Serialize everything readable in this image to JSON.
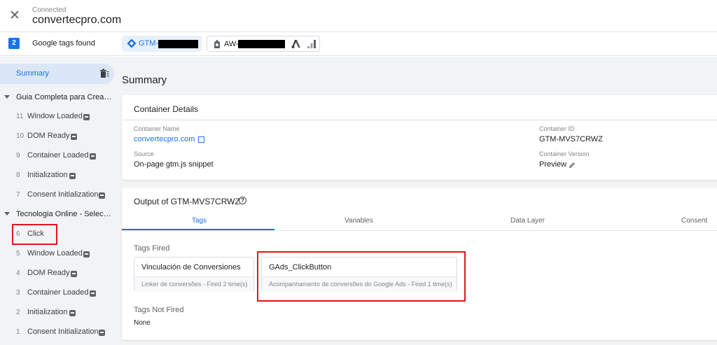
{
  "header": {
    "close_icon": "close-icon",
    "connected_label": "Connected",
    "domain": "convertecpro.com"
  },
  "tagbar": {
    "count": "2",
    "found_label": "Google tags found",
    "chips": [
      {
        "label": "GTM-",
        "icon": "gtm-diamond-icon",
        "accent": "#1a73e8"
      },
      {
        "label": "AW-",
        "icon": "google-ads-tag-icon"
      }
    ]
  },
  "sidebar": {
    "summary_label": "Summary",
    "clear_icon": "clear-all-icon",
    "sections": [
      {
        "title": "Guia Completa para Crear ...",
        "events": [
          {
            "num": "11",
            "label": "Window Loaded"
          },
          {
            "num": "10",
            "label": "DOM Ready"
          },
          {
            "num": "9",
            "label": "Container Loaded"
          },
          {
            "num": "8",
            "label": "Initialization"
          },
          {
            "num": "7",
            "label": "Consent Initialization"
          }
        ]
      },
      {
        "title": "Tecnologia Online - Selecc...",
        "events": [
          {
            "num": "6",
            "label": "Click"
          },
          {
            "num": "5",
            "label": "Window Loaded"
          },
          {
            "num": "4",
            "label": "DOM Ready"
          },
          {
            "num": "3",
            "label": "Container Loaded"
          },
          {
            "num": "2",
            "label": "Initialization"
          },
          {
            "num": "1",
            "label": "Consent Initialization"
          }
        ]
      }
    ]
  },
  "main": {
    "title": "Summary",
    "container_details": {
      "title": "Container Details",
      "container_name_label": "Container Name",
      "container_name": "convertecpro.com",
      "source_label": "Source",
      "source": "On-page gtm.js snippet",
      "container_id_label": "Container ID",
      "container_id": "GTM-MVS7CRWZ",
      "container_version_label": "Container Version",
      "container_version": "Preview"
    },
    "output": {
      "title": "Output of GTM-MVS7CRWZ",
      "help_icon": "?",
      "tabs": [
        "Tags",
        "Variables",
        "Data Layer",
        "Consent"
      ],
      "active_tab": "Tags",
      "tags_fired_label": "Tags Fired",
      "tags_fired": [
        {
          "name": "Vinculación de Conversiones",
          "detail": "Linker de conversões - Fired 2 time(s)"
        },
        {
          "name": "GAds_ClickButton",
          "detail": "Acompanhamento de conversões do Google Ads - Fired 1 time(s)"
        }
      ],
      "tags_not_fired_label": "Tags Not Fired",
      "tags_not_fired": "None"
    }
  },
  "colors": {
    "accent": "#1a73e8",
    "highlight": "#e0161e"
  }
}
